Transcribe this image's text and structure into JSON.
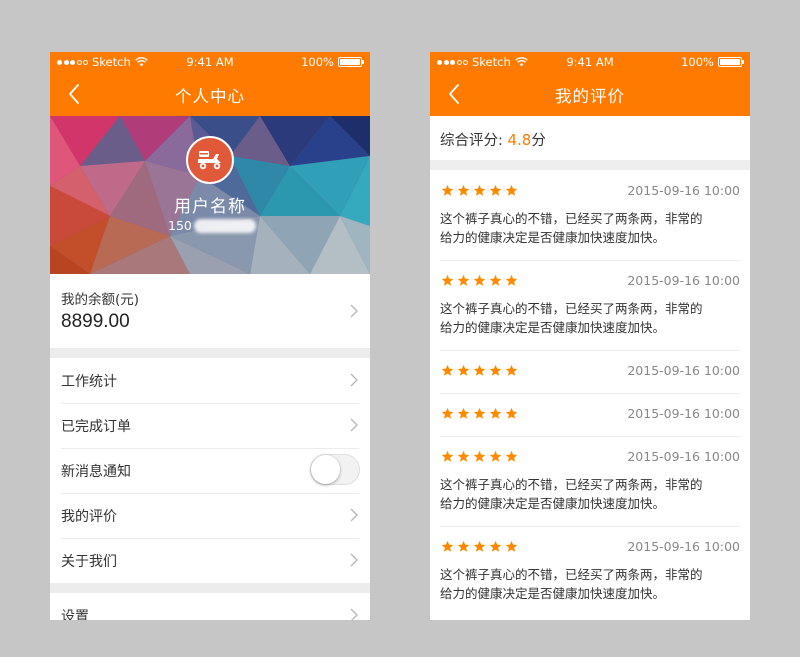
{
  "status_bar": {
    "carrier": "Sketch",
    "time": "9:41 AM",
    "battery": "100%"
  },
  "profile_screen": {
    "title": "个人中心",
    "username": "用户名称",
    "phone_prefix": "150",
    "balance_label": "我的余额(元)",
    "balance_value": "8899.00",
    "menu_group1": [
      {
        "label": "工作统计",
        "type": "link"
      },
      {
        "label": "已完成订单",
        "type": "link"
      },
      {
        "label": "新消息通知",
        "type": "toggle",
        "toggle_on": false
      },
      {
        "label": "我的评价",
        "type": "link"
      },
      {
        "label": "关于我们",
        "type": "link"
      }
    ],
    "menu_group2": [
      {
        "label": "设置",
        "type": "link"
      }
    ]
  },
  "reviews_screen": {
    "title": "我的评价",
    "score_label": "综合评分:",
    "score_value": "4.8",
    "score_unit": "分",
    "reviews": [
      {
        "rating": 5,
        "date": "2015-09-16 10:00",
        "text_line1": "这个裤子真心的不错，已经买了两条两，非常的",
        "text_line2": "给力的健康决定是否健康加快速度加快。"
      },
      {
        "rating": 5,
        "date": "2015-09-16 10:00",
        "text_line1": "这个裤子真心的不错，已经买了两条两，非常的",
        "text_line2": "给力的健康决定是否健康加快速度加快。"
      },
      {
        "rating": 5,
        "date": "2015-09-16 10:00",
        "text_line1": "",
        "text_line2": ""
      },
      {
        "rating": 5,
        "date": "2015-09-16 10:00",
        "text_line1": "",
        "text_line2": ""
      },
      {
        "rating": 5,
        "date": "2015-09-16 10:00",
        "text_line1": "这个裤子真心的不错，已经买了两条两，非常的",
        "text_line2": "给力的健康决定是否健康加快速度加快。"
      },
      {
        "rating": 5,
        "date": "2015-09-16 10:00",
        "text_line1": "这个裤子真心的不错，已经买了两条两，非常的",
        "text_line2": "给力的健康决定是否健康加快速度加快。"
      }
    ]
  },
  "colors": {
    "accent": "#ff7a00",
    "background": "#c6c6c6"
  },
  "icons": {
    "back": "chevron-left-icon",
    "chevron": "chevron-right-icon",
    "avatar": "scooter-icon",
    "star": "star-icon",
    "wifi": "wifi-icon",
    "battery": "battery-icon"
  }
}
